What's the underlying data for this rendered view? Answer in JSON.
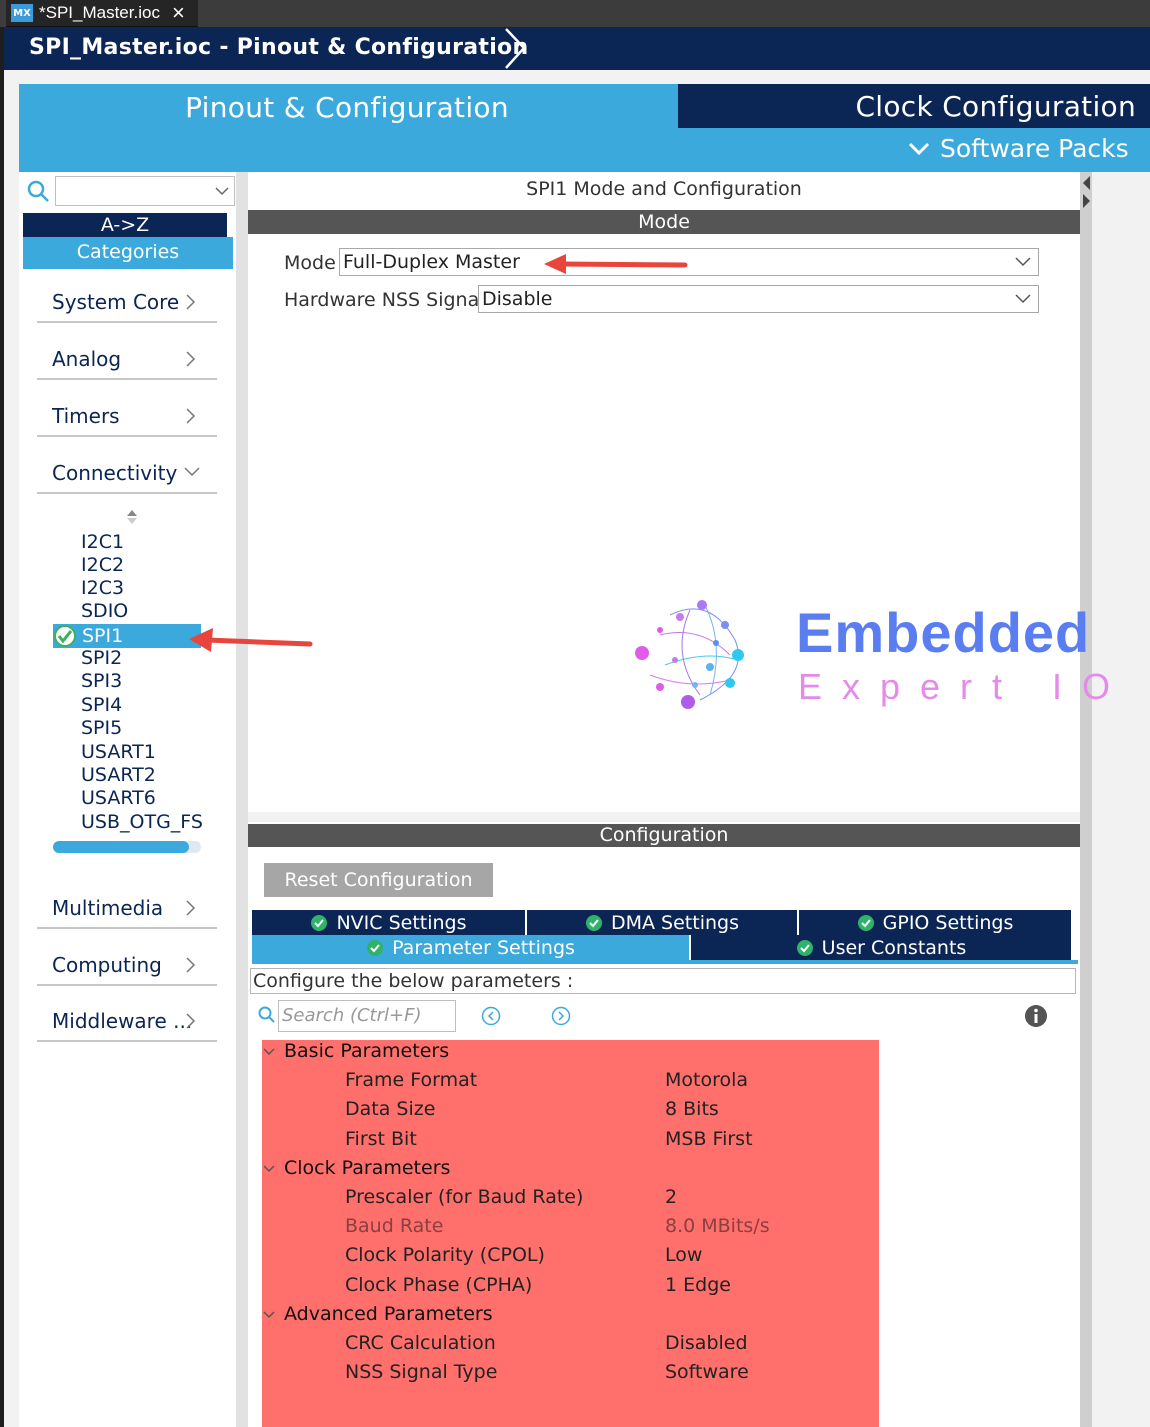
{
  "editor_tab": {
    "badge": "MX",
    "title": "*SPI_Master.ioc"
  },
  "breadcrumb": "SPI_Master.ioc - Pinout & Configuration",
  "top_tabs": {
    "pinout": "Pinout & Configuration",
    "clock": "Clock Configuration",
    "software_packs": "Software Packs"
  },
  "sidebar": {
    "sort_az": "A->Z",
    "categories": "Categories",
    "groups": [
      {
        "label": "System Core",
        "expanded": false
      },
      {
        "label": "Analog",
        "expanded": false
      },
      {
        "label": "Timers",
        "expanded": false
      },
      {
        "label": "Connectivity",
        "expanded": true
      },
      {
        "label": "Multimedia",
        "expanded": false
      },
      {
        "label": "Computing",
        "expanded": false
      },
      {
        "label": "Middleware ...",
        "expanded": false
      }
    ],
    "connectivity_items": [
      "I2C1",
      "I2C2",
      "I2C3",
      "SDIO",
      "SPI1",
      "SPI2",
      "SPI3",
      "SPI4",
      "SPI5",
      "USART1",
      "USART2",
      "USART6",
      "USB_OTG_FS"
    ],
    "selected_item": "SPI1"
  },
  "mode_panel": {
    "title": "SPI1 Mode and Configuration",
    "section": "Mode",
    "mode_label": "Mode",
    "mode_value": "Full-Duplex Master",
    "nss_label": "Hardware NSS Signal",
    "nss_value": "Disable"
  },
  "watermark": {
    "line1": "Embedded",
    "line2": "Expert IO"
  },
  "config_panel": {
    "section": "Configuration",
    "reset_button": "Reset Configuration",
    "tabs": [
      "NVIC Settings",
      "DMA Settings",
      "GPIO Settings",
      "Parameter Settings",
      "User Constants"
    ],
    "active_tab": "Parameter Settings",
    "hint": "Configure the below parameters :",
    "search_placeholder": "Search (Ctrl+F)",
    "groups": [
      {
        "name": "Basic Parameters",
        "params": [
          {
            "name": "Frame Format",
            "value": "Motorola"
          },
          {
            "name": "Data Size",
            "value": "8 Bits"
          },
          {
            "name": "First Bit",
            "value": "MSB First"
          }
        ]
      },
      {
        "name": "Clock Parameters",
        "params": [
          {
            "name": "Prescaler (for Baud Rate)",
            "value": "2"
          },
          {
            "name": "Baud Rate",
            "value": "8.0 MBits/s",
            "readonly": true
          },
          {
            "name": "Clock Polarity (CPOL)",
            "value": "Low"
          },
          {
            "name": "Clock Phase (CPHA)",
            "value": "1 Edge"
          }
        ]
      },
      {
        "name": "Advanced Parameters",
        "params": [
          {
            "name": "CRC Calculation",
            "value": "Disabled"
          },
          {
            "name": "NSS Signal Type",
            "value": "Software"
          }
        ]
      }
    ]
  },
  "colors": {
    "navy": "#0b2554",
    "blue": "#3ca9dc",
    "highlight": "#ff6f6b",
    "arrow": "#e8453c"
  }
}
